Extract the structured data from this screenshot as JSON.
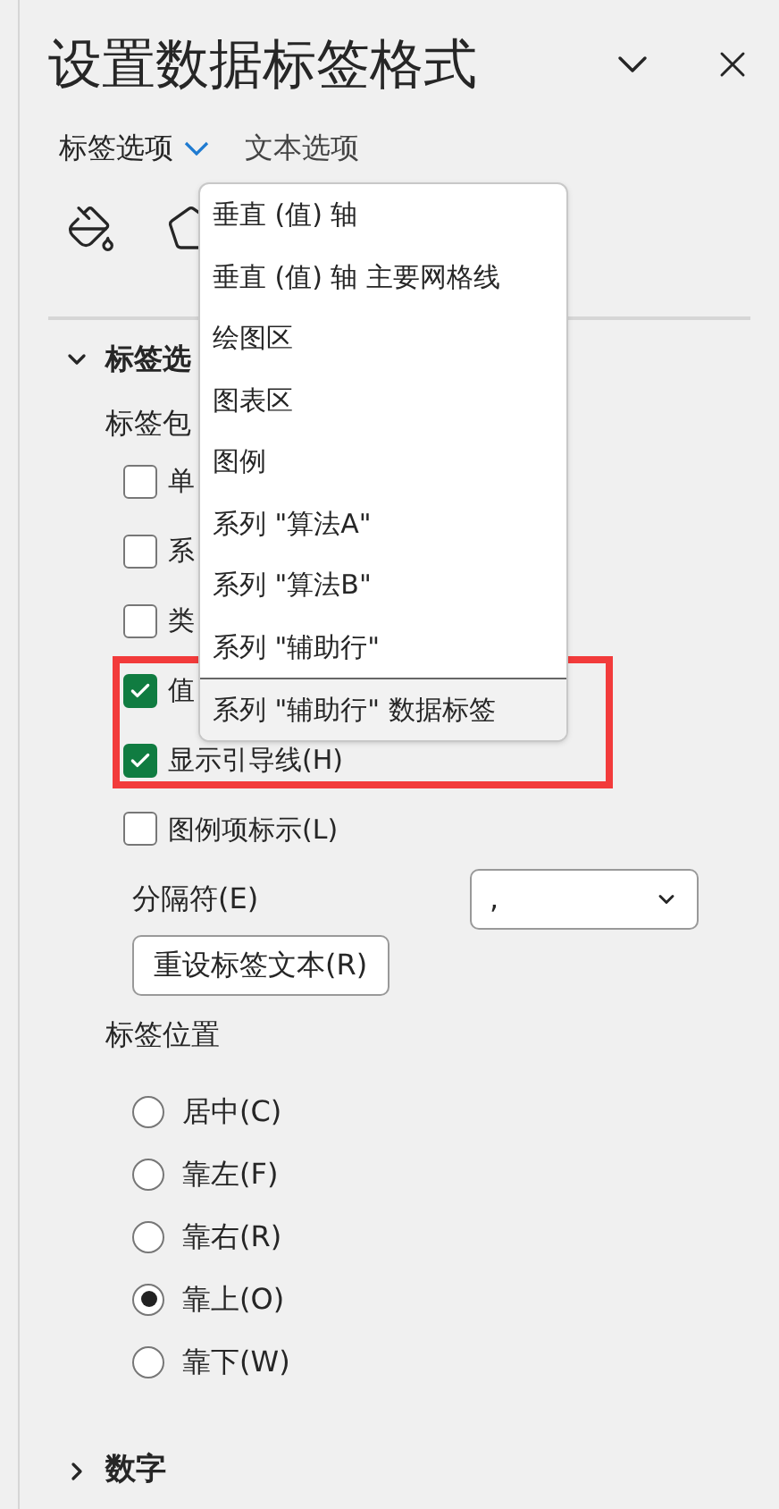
{
  "panel": {
    "title": "设置数据标签格式"
  },
  "tabs": [
    {
      "label": "标签选项",
      "selected": true
    },
    {
      "label": "文本选项",
      "selected": false
    }
  ],
  "dropdown": {
    "items": [
      {
        "label": "垂直 (值) 轴",
        "selected": false
      },
      {
        "label": "垂直 (值) 轴 主要网格线",
        "selected": false
      },
      {
        "label": "绘图区",
        "selected": false
      },
      {
        "label": "图表区",
        "selected": false
      },
      {
        "label": "图例",
        "selected": false
      },
      {
        "label": "系列 \"算法A\"",
        "selected": false
      },
      {
        "label": "系列 \"算法B\"",
        "selected": false
      },
      {
        "label": "系列 \"辅助行\"",
        "selected": false
      },
      {
        "label": "系列 \"辅助行\" 数据标签",
        "selected": true
      }
    ]
  },
  "section": {
    "title": "标签选",
    "expanded": true
  },
  "group_label": "标签包",
  "checkboxes": [
    {
      "label": "单",
      "checked": false
    },
    {
      "label": "系",
      "checked": false
    },
    {
      "label": "类",
      "checked": false
    },
    {
      "label": "值",
      "checked": true
    },
    {
      "label": "显示引导线(H)",
      "checked": true
    },
    {
      "label": "图例项标示(L)",
      "checked": false
    }
  ],
  "separator": {
    "label": "分隔符(E)",
    "value": ","
  },
  "reset_button": "重设标签文本(R)",
  "position": {
    "title": "标签位置",
    "options": [
      {
        "label": "居中(C)",
        "selected": false
      },
      {
        "label": "靠左(F)",
        "selected": false
      },
      {
        "label": "靠右(R)",
        "selected": false
      },
      {
        "label": "靠上(O)",
        "selected": true
      },
      {
        "label": "靠下(W)",
        "selected": false
      }
    ]
  },
  "collapsed_section": {
    "title": "数字",
    "expanded": false
  }
}
